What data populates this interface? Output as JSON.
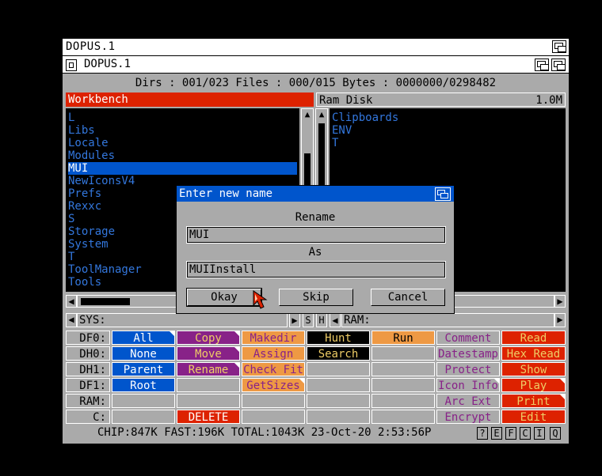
{
  "screen_title": "DOPUS.1",
  "window_title": "DOPUS.1",
  "status_line": "Dirs : 001/023  Files : 000/015  Bytes : 0000000/0298482",
  "left_lister": {
    "header": "Workbench",
    "entries": [
      "L",
      "Libs",
      "Locale",
      "Modules",
      "MUI",
      "NewIconsV4",
      "Prefs",
      "Rexxc",
      "S",
      "Storage",
      "System",
      "T",
      "ToolManager",
      "Tools"
    ],
    "selected": "MUI",
    "path": "SYS:"
  },
  "right_lister": {
    "header": "Ram Disk",
    "free": "1.0M",
    "entries": [
      "Clipboards",
      "ENV",
      "T"
    ],
    "path": "RAM:"
  },
  "mid_buttons": {
    "s": "S",
    "h": "H"
  },
  "devices": [
    "DF0:",
    "DH0:",
    "DH1:",
    "DF1:",
    "RAM:",
    "C:"
  ],
  "button_bank": {
    "col1": [
      "All",
      "None",
      "Parent",
      "Root",
      "",
      ""
    ],
    "col2": [
      "Copy",
      "Move",
      "Rename",
      "",
      "",
      "DELETE"
    ],
    "col3": [
      "Makedir",
      "Assign",
      "Check Fit",
      "GetSizes",
      "",
      ""
    ],
    "col4": [
      "Hunt",
      "Search",
      "",
      "",
      "",
      ""
    ],
    "col5": [
      "Run",
      "",
      "",
      "",
      "",
      ""
    ],
    "col6": [
      "Comment",
      "Datestamp",
      "Protect",
      "Icon Info",
      "Arc Ext",
      "Encrypt"
    ],
    "col7": [
      "Read",
      "Hex Read",
      "Show",
      "Play",
      "Print",
      "Edit"
    ]
  },
  "bottom_info": "CHIP:847K  FAST:196K  TOTAL:1043K  23-Oct-20   2:53:56P",
  "bottom_buttons": [
    "?",
    "E",
    "F",
    "C",
    "I",
    "Q"
  ],
  "dialog": {
    "title": "Enter new name",
    "label1": "Rename",
    "value1": "MUI",
    "label2": "As",
    "value2": "MUIInstall",
    "okay": "Okay",
    "skip": "Skip",
    "cancel": "Cancel"
  },
  "colors": {
    "blue": "#0055cc",
    "red": "#dd2200",
    "purple": "#882288",
    "orange": "#ee9944",
    "black": "#000000",
    "gray": "#aaaaaa",
    "list_text": "#3377dd"
  }
}
